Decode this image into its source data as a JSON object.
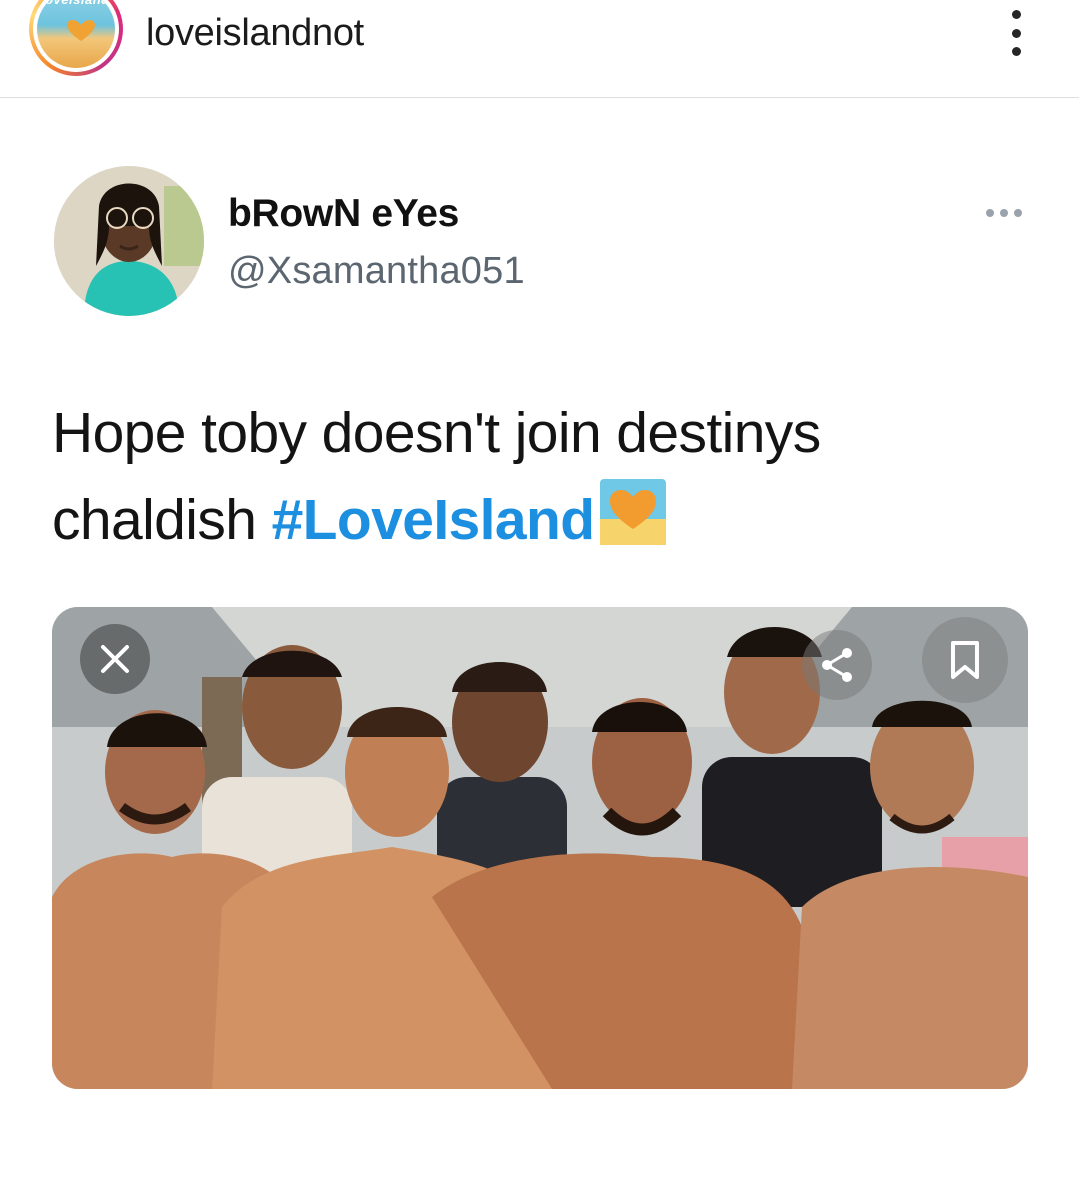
{
  "instagram": {
    "username": "loveislandnot",
    "avatar_logo_text": "loveisland",
    "more_icon": "vertical-ellipsis-icon"
  },
  "tweet": {
    "display_name": "bRowN eYes",
    "handle": "@Xsamantha051",
    "text_prefix": "Hope toby doesn't join destinys chaldish ",
    "hashtag": "#LoveIsland",
    "emoji": "love-island-heart-emoji",
    "more_icon": "horizontal-ellipsis-icon"
  },
  "media": {
    "description_icon": "photo",
    "close_icon": "close-icon",
    "share_icon": "share-icon",
    "save_icon": "bookmark-icon"
  },
  "colors": {
    "hashtag": "#1d8fe0",
    "handle": "#5b6670",
    "divider": "#dedede"
  }
}
